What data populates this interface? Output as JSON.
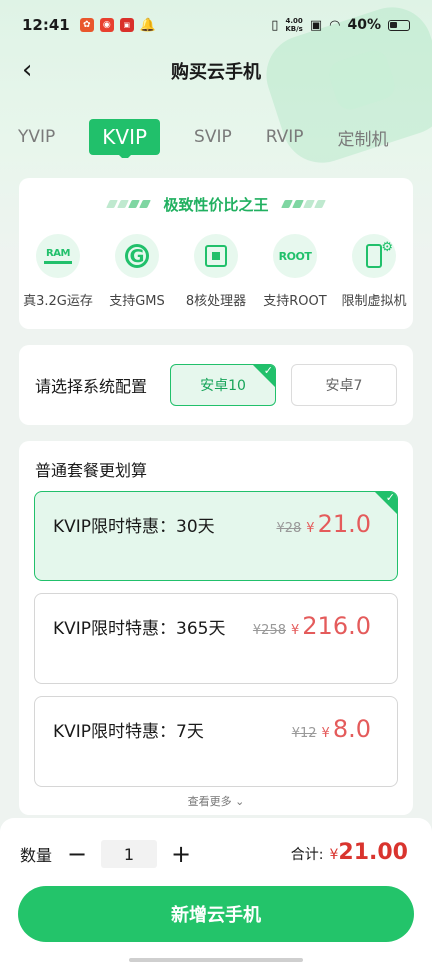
{
  "status_bar": {
    "time": "12:41",
    "net_speed_value": "4.00",
    "net_speed_unit": "KB/s",
    "battery": "40%"
  },
  "header": {
    "title": "购买云手机"
  },
  "tabs": [
    {
      "label": "YVIP",
      "active": false
    },
    {
      "label": "KVIP",
      "active": true
    },
    {
      "label": "SVIP",
      "active": false
    },
    {
      "label": "RVIP",
      "active": false
    },
    {
      "label": "定制机",
      "active": false
    }
  ],
  "features": {
    "title": "极致性价比之王",
    "items": [
      {
        "icon": "ram-icon",
        "icon_text": "RAM",
        "label": "真3.2G运存"
      },
      {
        "icon": "google-gms-icon",
        "icon_text": "G",
        "label": "支持GMS"
      },
      {
        "icon": "cpu-chip-icon",
        "icon_text": "",
        "label": "8核处理器"
      },
      {
        "icon": "root-icon",
        "icon_text": "ROOT",
        "label": "支持ROOT"
      },
      {
        "icon": "phone-settings-icon",
        "icon_text": "",
        "label": "限制虚拟机"
      }
    ]
  },
  "system": {
    "label": "请选择系统配置",
    "options": [
      {
        "label": "安卓10",
        "selected": true
      },
      {
        "label": "安卓7",
        "selected": false
      }
    ]
  },
  "plans": {
    "title": "普通套餐更划算",
    "items": [
      {
        "name": "KVIP限时特惠：30天",
        "old_price": "¥28",
        "currency": "¥",
        "price": "21.0",
        "selected": true
      },
      {
        "name": "KVIP限时特惠：365天",
        "old_price": "¥258",
        "currency": "¥",
        "price": "216.0",
        "selected": false
      },
      {
        "name": "KVIP限时特惠：7天",
        "old_price": "¥12",
        "currency": "¥",
        "price": "8.0",
        "selected": false
      }
    ],
    "more_label": "查看更多 ⌄"
  },
  "footer": {
    "quantity_label": "数量",
    "minus": "−",
    "plus": "+",
    "quantity": "1",
    "total_label": "合计:",
    "total_currency": "¥",
    "total_value": "21.00",
    "cta_label": "新增云手机"
  },
  "colors": {
    "accent": "#21c06b",
    "price": "#e45b5b",
    "total": "#d9342e"
  }
}
